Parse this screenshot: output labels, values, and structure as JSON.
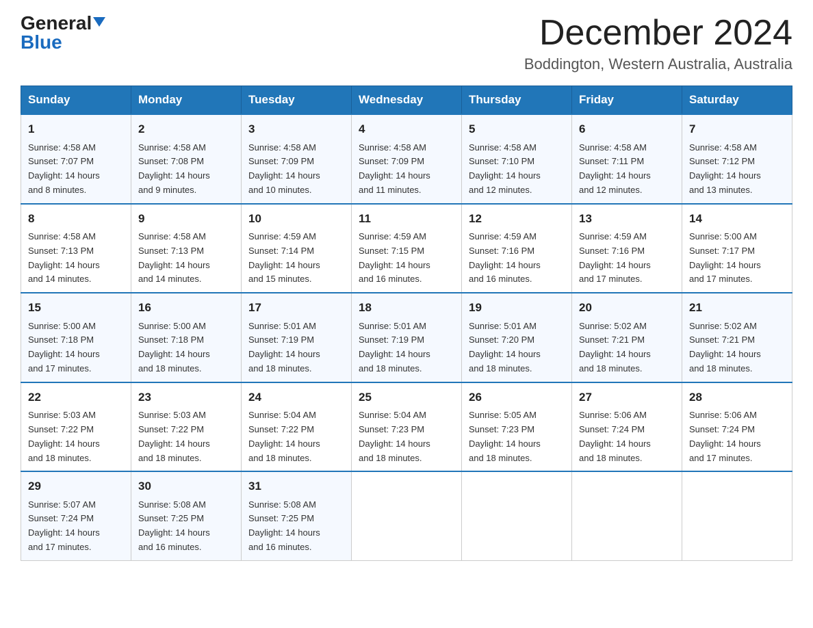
{
  "header": {
    "logo_general": "General",
    "logo_blue": "Blue",
    "month": "December 2024",
    "location": "Boddington, Western Australia, Australia"
  },
  "days_of_week": [
    "Sunday",
    "Monday",
    "Tuesday",
    "Wednesday",
    "Thursday",
    "Friday",
    "Saturday"
  ],
  "weeks": [
    [
      {
        "day": "1",
        "sunrise": "4:58 AM",
        "sunset": "7:07 PM",
        "daylight": "14 hours and 8 minutes."
      },
      {
        "day": "2",
        "sunrise": "4:58 AM",
        "sunset": "7:08 PM",
        "daylight": "14 hours and 9 minutes."
      },
      {
        "day": "3",
        "sunrise": "4:58 AM",
        "sunset": "7:09 PM",
        "daylight": "14 hours and 10 minutes."
      },
      {
        "day": "4",
        "sunrise": "4:58 AM",
        "sunset": "7:09 PM",
        "daylight": "14 hours and 11 minutes."
      },
      {
        "day": "5",
        "sunrise": "4:58 AM",
        "sunset": "7:10 PM",
        "daylight": "14 hours and 12 minutes."
      },
      {
        "day": "6",
        "sunrise": "4:58 AM",
        "sunset": "7:11 PM",
        "daylight": "14 hours and 12 minutes."
      },
      {
        "day": "7",
        "sunrise": "4:58 AM",
        "sunset": "7:12 PM",
        "daylight": "14 hours and 13 minutes."
      }
    ],
    [
      {
        "day": "8",
        "sunrise": "4:58 AM",
        "sunset": "7:13 PM",
        "daylight": "14 hours and 14 minutes."
      },
      {
        "day": "9",
        "sunrise": "4:58 AM",
        "sunset": "7:13 PM",
        "daylight": "14 hours and 14 minutes."
      },
      {
        "day": "10",
        "sunrise": "4:59 AM",
        "sunset": "7:14 PM",
        "daylight": "14 hours and 15 minutes."
      },
      {
        "day": "11",
        "sunrise": "4:59 AM",
        "sunset": "7:15 PM",
        "daylight": "14 hours and 16 minutes."
      },
      {
        "day": "12",
        "sunrise": "4:59 AM",
        "sunset": "7:16 PM",
        "daylight": "14 hours and 16 minutes."
      },
      {
        "day": "13",
        "sunrise": "4:59 AM",
        "sunset": "7:16 PM",
        "daylight": "14 hours and 17 minutes."
      },
      {
        "day": "14",
        "sunrise": "5:00 AM",
        "sunset": "7:17 PM",
        "daylight": "14 hours and 17 minutes."
      }
    ],
    [
      {
        "day": "15",
        "sunrise": "5:00 AM",
        "sunset": "7:18 PM",
        "daylight": "14 hours and 17 minutes."
      },
      {
        "day": "16",
        "sunrise": "5:00 AM",
        "sunset": "7:18 PM",
        "daylight": "14 hours and 18 minutes."
      },
      {
        "day": "17",
        "sunrise": "5:01 AM",
        "sunset": "7:19 PM",
        "daylight": "14 hours and 18 minutes."
      },
      {
        "day": "18",
        "sunrise": "5:01 AM",
        "sunset": "7:19 PM",
        "daylight": "14 hours and 18 minutes."
      },
      {
        "day": "19",
        "sunrise": "5:01 AM",
        "sunset": "7:20 PM",
        "daylight": "14 hours and 18 minutes."
      },
      {
        "day": "20",
        "sunrise": "5:02 AM",
        "sunset": "7:21 PM",
        "daylight": "14 hours and 18 minutes."
      },
      {
        "day": "21",
        "sunrise": "5:02 AM",
        "sunset": "7:21 PM",
        "daylight": "14 hours and 18 minutes."
      }
    ],
    [
      {
        "day": "22",
        "sunrise": "5:03 AM",
        "sunset": "7:22 PM",
        "daylight": "14 hours and 18 minutes."
      },
      {
        "day": "23",
        "sunrise": "5:03 AM",
        "sunset": "7:22 PM",
        "daylight": "14 hours and 18 minutes."
      },
      {
        "day": "24",
        "sunrise": "5:04 AM",
        "sunset": "7:22 PM",
        "daylight": "14 hours and 18 minutes."
      },
      {
        "day": "25",
        "sunrise": "5:04 AM",
        "sunset": "7:23 PM",
        "daylight": "14 hours and 18 minutes."
      },
      {
        "day": "26",
        "sunrise": "5:05 AM",
        "sunset": "7:23 PM",
        "daylight": "14 hours and 18 minutes."
      },
      {
        "day": "27",
        "sunrise": "5:06 AM",
        "sunset": "7:24 PM",
        "daylight": "14 hours and 18 minutes."
      },
      {
        "day": "28",
        "sunrise": "5:06 AM",
        "sunset": "7:24 PM",
        "daylight": "14 hours and 17 minutes."
      }
    ],
    [
      {
        "day": "29",
        "sunrise": "5:07 AM",
        "sunset": "7:24 PM",
        "daylight": "14 hours and 17 minutes."
      },
      {
        "day": "30",
        "sunrise": "5:08 AM",
        "sunset": "7:25 PM",
        "daylight": "14 hours and 16 minutes."
      },
      {
        "day": "31",
        "sunrise": "5:08 AM",
        "sunset": "7:25 PM",
        "daylight": "14 hours and 16 minutes."
      },
      null,
      null,
      null,
      null
    ]
  ],
  "labels": {
    "sunrise": "Sunrise:",
    "sunset": "Sunset:",
    "daylight": "Daylight:"
  }
}
